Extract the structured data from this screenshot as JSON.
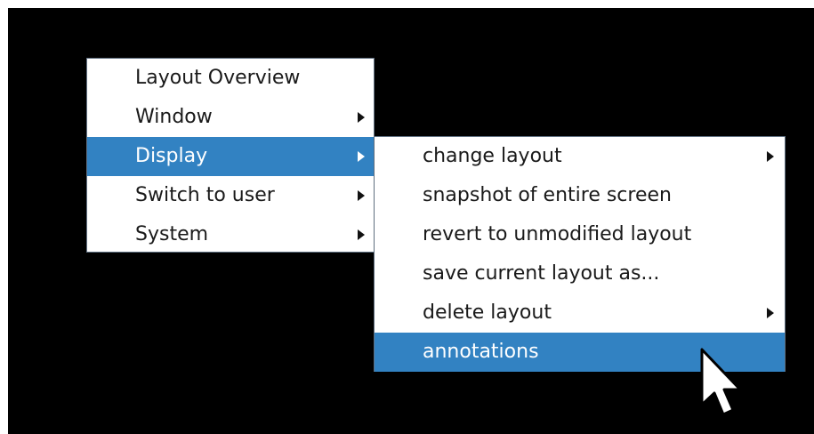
{
  "main_menu": {
    "items": [
      {
        "label": "Layout Overview",
        "has_submenu": false,
        "highlighted": false
      },
      {
        "label": "Window",
        "has_submenu": true,
        "highlighted": false
      },
      {
        "label": "Display",
        "has_submenu": true,
        "highlighted": true
      },
      {
        "label": "Switch to user",
        "has_submenu": true,
        "highlighted": false
      },
      {
        "label": "System",
        "has_submenu": true,
        "highlighted": false
      }
    ]
  },
  "display_submenu": {
    "items": [
      {
        "label": "change layout",
        "has_submenu": true,
        "highlighted": false
      },
      {
        "label": "snapshot of entire screen",
        "has_submenu": false,
        "highlighted": false
      },
      {
        "label": "revert to unmodified layout",
        "has_submenu": false,
        "highlighted": false
      },
      {
        "label": "save current layout as...",
        "has_submenu": false,
        "highlighted": false
      },
      {
        "label": "delete layout",
        "has_submenu": true,
        "highlighted": false
      },
      {
        "label": "annotations",
        "has_submenu": false,
        "highlighted": true
      }
    ]
  },
  "colors": {
    "background": "#000000",
    "menu_background": "#ffffff",
    "highlight": "#3282c2",
    "highlight_text": "#ffffff",
    "text": "#1a1a1a"
  },
  "icons": {
    "submenu_arrow": "triangle-right-icon",
    "pointer": "arrow-cursor-icon"
  }
}
